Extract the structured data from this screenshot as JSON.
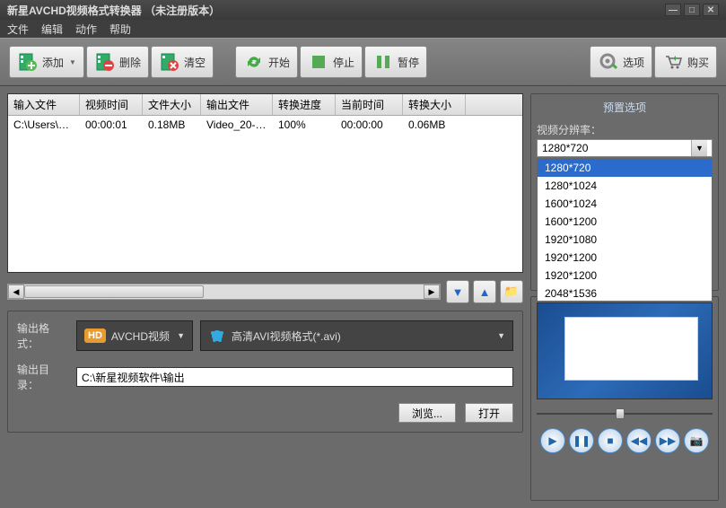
{
  "window": {
    "title": "新星AVCHD视频格式转换器  （未注册版本）"
  },
  "menu": {
    "file": "文件",
    "edit": "编辑",
    "action": "动作",
    "help": "帮助"
  },
  "toolbar": {
    "add": "添加",
    "delete": "删除",
    "clear": "清空",
    "start": "开始",
    "stop": "停止",
    "pause": "暂停",
    "options": "选项",
    "buy": "购买"
  },
  "table": {
    "headers": {
      "input": "输入文件",
      "videotime": "视频时间",
      "filesize": "文件大小",
      "output": "输出文件",
      "progress": "转换进度",
      "curtime": "当前时间",
      "convsize": "转换大小"
    },
    "rows": [
      {
        "input": "C:\\Users\\pc\\...",
        "videotime": "00:00:01",
        "filesize": "0.18MB",
        "output": "Video_20-0...",
        "progress": "100%",
        "curtime": "00:00:00",
        "convsize": "0.06MB"
      }
    ]
  },
  "output": {
    "format_label": "输出格式：",
    "format1": "AVCHD视频",
    "format2": "高清AVI视频格式(*.avi)",
    "dir_label": "输出目录：",
    "dir_value": "C:\\新星视频软件\\输出",
    "browse": "浏览...",
    "open": "打开"
  },
  "preset": {
    "title": "预置选项",
    "res_label": "视频分辨率：",
    "selected": "1280*720",
    "options": [
      "1280*720",
      "1280*1024",
      "1600*1024",
      "1600*1200",
      "1920*1080",
      "1920*1200",
      "1920*1200",
      "2048*1536"
    ]
  }
}
